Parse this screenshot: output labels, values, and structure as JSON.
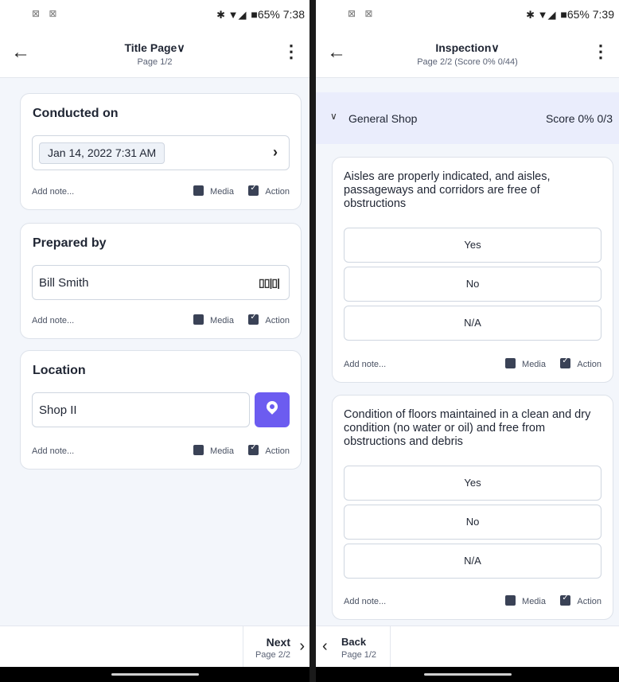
{
  "left": {
    "status": {
      "notif": "⊠ ⊠",
      "icons": "✱ ▼◢",
      "battery": "■65%",
      "time": "7:38"
    },
    "appbar": {
      "title": "Title Page∨",
      "subtitle": "Page 1/2"
    },
    "cards": {
      "conducted": {
        "title": "Conducted on",
        "value": "Jan 14, 2022 7:31 AM"
      },
      "prepared": {
        "title": "Prepared by",
        "value": "Bill Smith"
      },
      "location": {
        "title": "Location",
        "value": "Shop II"
      }
    },
    "footer": {
      "add_note": "Add note...",
      "media": "Media",
      "action": "Action"
    },
    "bottom": {
      "next": "Next",
      "next_sub": "Page 2/2"
    }
  },
  "right": {
    "status": {
      "notif": "⊠ ⊠",
      "icons": "✱ ▼◢",
      "battery": "■65%",
      "time": "7:39"
    },
    "appbar": {
      "title": "Inspection∨",
      "subtitle": "Page 2/2 (Score 0% 0/44)"
    },
    "section": {
      "title": "General Shop",
      "score": "Score 0% 0/3"
    },
    "questions": [
      {
        "text": "Aisles are properly indicated, and aisles, passageways and corridors are free of obstructions",
        "options": [
          "Yes",
          "No",
          "N/A"
        ]
      },
      {
        "text": "Condition of floors maintained in a clean and dry condition (no water or oil) and free from obstructions and debris",
        "options": [
          "Yes",
          "No",
          "N/A"
        ]
      }
    ],
    "footer": {
      "add_note": "Add note...",
      "media": "Media",
      "action": "Action"
    },
    "bottom": {
      "back": "Back",
      "back_sub": "Page 1/2"
    }
  }
}
